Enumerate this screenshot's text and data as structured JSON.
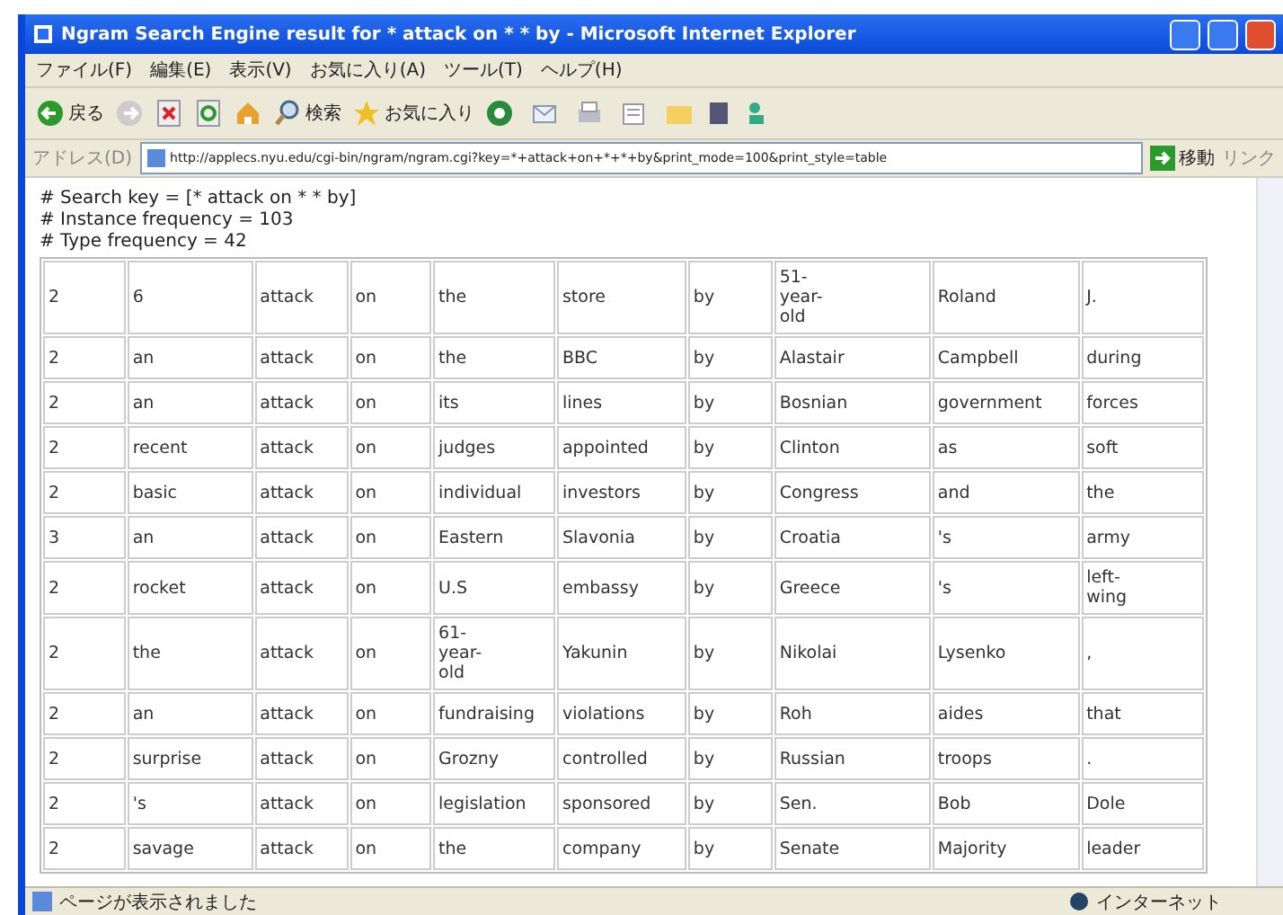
{
  "window": {
    "title": "Ngram Search Engine result for * attack on * * by - Microsoft Internet Explorer"
  },
  "menu": [
    "ファイル(F)",
    "編集(E)",
    "表示(V)",
    "お気に入り(A)",
    "ツール(T)",
    "ヘルプ(H)"
  ],
  "toolbar": {
    "back": "戻る",
    "search": "検索",
    "favorites": "お気に入り"
  },
  "address_bar": {
    "label": "アドレス(D)",
    "value": "http://applecs.nyu.edu/cgi-bin/ngram/ngram.cgi?key=*+attack+on+*+*+by&print_mode=100&print_style=table",
    "go": "移動",
    "links": "リンク"
  },
  "info_lines": [
    "# Search key = [* attack on * * by]",
    "# Instance frequency = 103",
    "# Type frequency = 42"
  ],
  "table": {
    "rows": [
      [
        "2",
        "6",
        "attack",
        "on",
        "the",
        "store",
        "by",
        "51-\nyear-\nold",
        "Roland",
        "J."
      ],
      [
        "2",
        "an",
        "attack",
        "on",
        "the",
        "BBC",
        "by",
        "Alastair",
        "Campbell",
        "during"
      ],
      [
        "2",
        "an",
        "attack",
        "on",
        "its",
        "lines",
        "by",
        "Bosnian",
        "government",
        "forces"
      ],
      [
        "2",
        "recent",
        "attack",
        "on",
        "judges",
        "appointed",
        "by",
        "Clinton",
        "as",
        "soft"
      ],
      [
        "2",
        "basic",
        "attack",
        "on",
        "individual",
        "investors",
        "by",
        "Congress",
        "and",
        "the"
      ],
      [
        "3",
        "an",
        "attack",
        "on",
        "Eastern",
        "Slavonia",
        "by",
        "Croatia",
        "'s",
        "army"
      ],
      [
        "2",
        "rocket",
        "attack",
        "on",
        "U.S",
        "embassy",
        "by",
        "Greece",
        "'s",
        "left-\nwing"
      ],
      [
        "2",
        "the",
        "attack",
        "on",
        "61-\nyear-\nold",
        "Yakunin",
        "by",
        "Nikolai",
        "Lysenko",
        ","
      ],
      [
        "2",
        "an",
        "attack",
        "on",
        "fundraising",
        "violations",
        "by",
        "Roh",
        "aides",
        "that"
      ],
      [
        "2",
        "surprise",
        "attack",
        "on",
        "Grozny",
        "controlled",
        "by",
        "Russian",
        "troops",
        "."
      ],
      [
        "2",
        "'s",
        "attack",
        "on",
        "legislation",
        "sponsored",
        "by",
        "Sen.",
        "Bob",
        "Dole"
      ],
      [
        "2",
        "savage",
        "attack",
        "on",
        "the",
        "company",
        "by",
        "Senate",
        "Majority",
        "leader"
      ]
    ]
  },
  "status_bar": {
    "message": "ページが表示されました",
    "zone": "インターネット"
  }
}
